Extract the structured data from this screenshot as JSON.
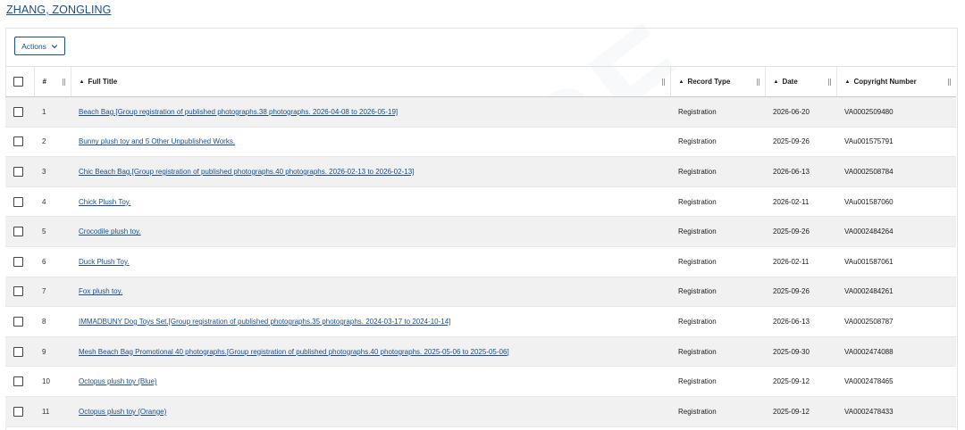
{
  "author": {
    "name": "ZHANG, ZONGLING"
  },
  "toolbar": {
    "actions_label": "Actions"
  },
  "table": {
    "headers": {
      "index": "#",
      "full_title": "Full Title",
      "record_type": "Record Type",
      "date": "Date",
      "copyright_number": "Copyright Number"
    },
    "rows": [
      {
        "n": "1",
        "title": "Beach Bag.[Group registration of published photographs.38 photographs. 2026-04-08 to 2026-05-19]",
        "type": "Registration",
        "date": "2026-06-20",
        "copyright": "VA0002509480"
      },
      {
        "n": "2",
        "title": "Bunny plush toy and 5 Other Unpublished Works.",
        "type": "Registration",
        "date": "2025-09-26",
        "copyright": "VAu001575791"
      },
      {
        "n": "3",
        "title": "Chic Beach Bag.[Group registration of published photographs.40 photographs. 2026-02-13 to 2026-02-13]",
        "type": "Registration",
        "date": "2026-06-13",
        "copyright": "VA0002508784"
      },
      {
        "n": "4",
        "title": "Chick Plush Toy.",
        "type": "Registration",
        "date": "2026-02-11",
        "copyright": "VAu001587060"
      },
      {
        "n": "5",
        "title": "Crocodile plush toy.",
        "type": "Registration",
        "date": "2025-09-26",
        "copyright": "VA0002484264"
      },
      {
        "n": "6",
        "title": "Duck Plush Toy.",
        "type": "Registration",
        "date": "2026-02-11",
        "copyright": "VAu001587061"
      },
      {
        "n": "7",
        "title": "Fox plush toy.",
        "type": "Registration",
        "date": "2025-09-26",
        "copyright": "VA0002484261"
      },
      {
        "n": "8",
        "title": "IMMADBUNY Dog Toys Set.[Group registration of published photographs.35 photographs. 2024-03-17 to 2024-10-14]",
        "type": "Registration",
        "date": "2026-06-13",
        "copyright": "VA0002508787"
      },
      {
        "n": "9",
        "title": "Mesh Beach Bag Promotional 40 photographs.[Group registration of published photographs.40 photographs. 2025-05-06 to 2025-05-06]",
        "type": "Registration",
        "date": "2025-09-30",
        "copyright": "VA0002474088"
      },
      {
        "n": "10",
        "title": "Octopus plush toy (Blue)",
        "type": "Registration",
        "date": "2025-09-12",
        "copyright": "VA0002478465"
      },
      {
        "n": "11",
        "title": "Octopus plush toy (Orange)",
        "type": "Registration",
        "date": "2025-09-12",
        "copyright": "VA0002478433"
      }
    ]
  },
  "watermark": {
    "text": "123RF"
  },
  "colors": {
    "link": "#1a4f8b",
    "row_alt": "#f1f1f1"
  },
  "icons": {
    "actions_caret": "chevron-down-icon",
    "sort": "sort-up-icon",
    "checkbox": "checkbox-icon"
  }
}
